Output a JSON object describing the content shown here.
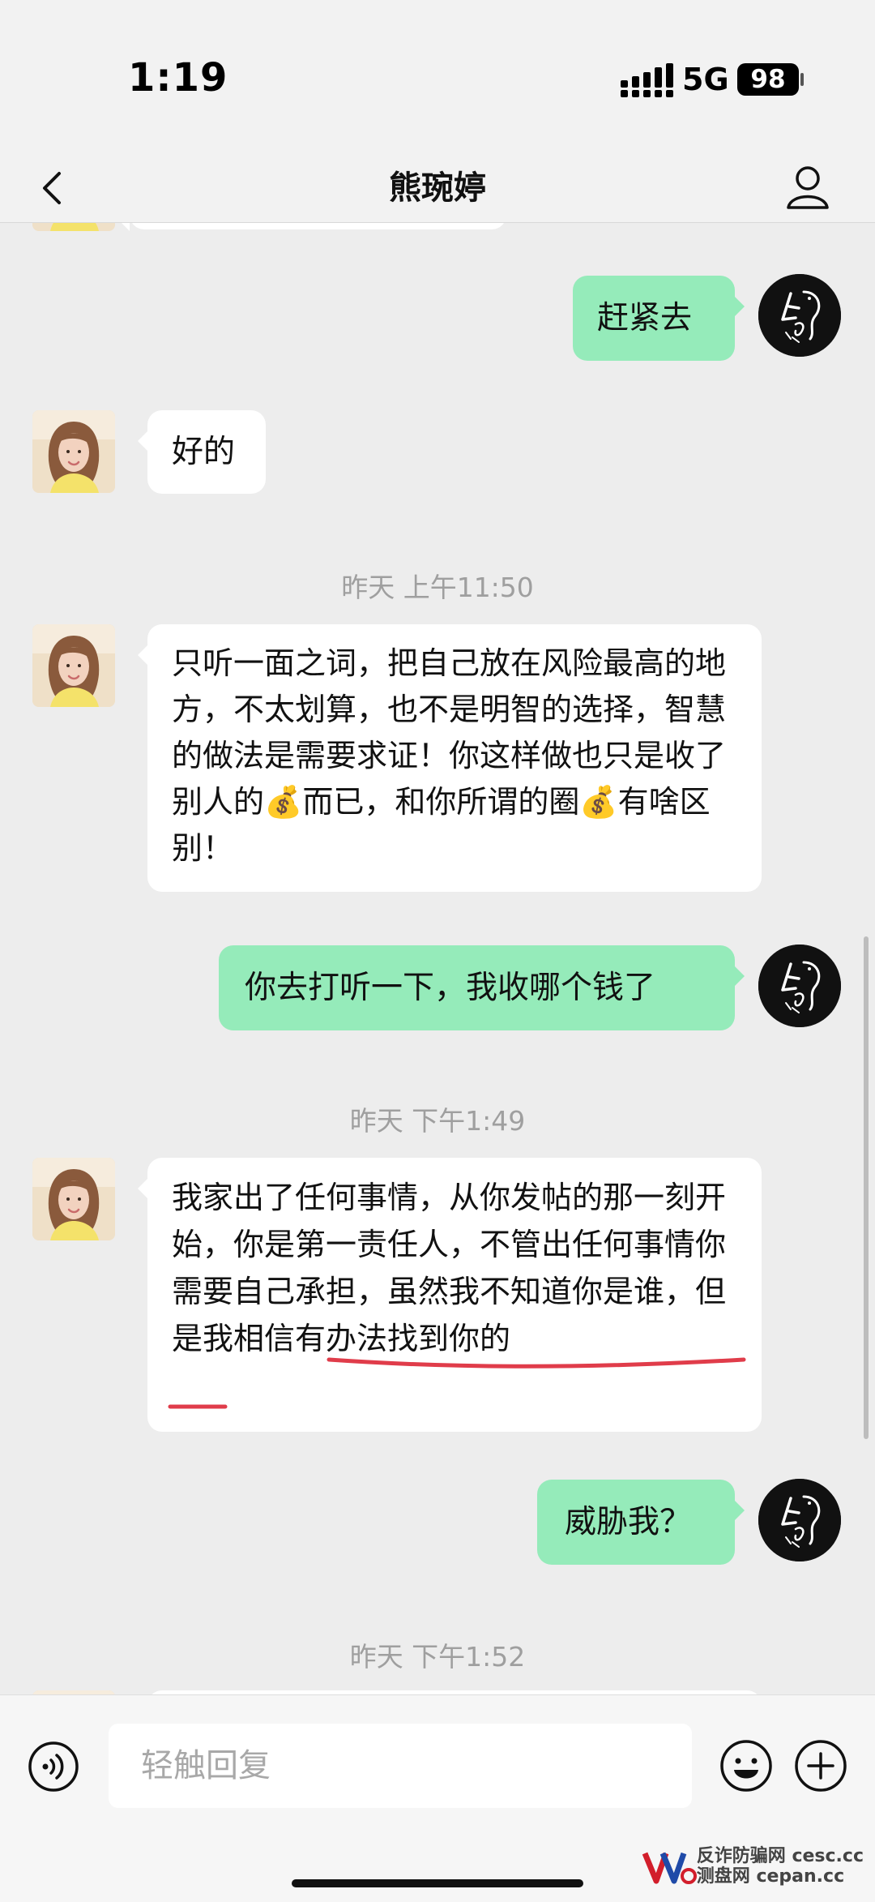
{
  "status_bar": {
    "time": "1:19",
    "network": "5G",
    "battery": "98"
  },
  "header": {
    "title": "熊琬婷",
    "back_icon": "chevron-left-icon",
    "profile_icon": "person-icon"
  },
  "messages": [
    {
      "kind": "message",
      "side": "out",
      "text": "赶紧去"
    },
    {
      "kind": "message",
      "side": "in",
      "text": "好的"
    },
    {
      "kind": "time",
      "text": "昨天 上午11:50"
    },
    {
      "kind": "message",
      "side": "in",
      "text": "只听一面之词，把自己放在风险最高的地方，不太划算，也不是明智的选择，智慧的做法是需要求证！你这样做也只是收了别人的💰而已，和你所谓的圈💰有啥区别！"
    },
    {
      "kind": "message",
      "side": "out",
      "text": "你去打听一下，我收哪个钱了"
    },
    {
      "kind": "time",
      "text": "昨天 下午1:49"
    },
    {
      "kind": "message",
      "side": "in",
      "text": "我家出了任何事情，从你发帖的那一刻开始，你是第一责任人，不管出任何事情你需要自己承担，虽然我不知道你是谁，但是我相信有办法找到你的"
    },
    {
      "kind": "message",
      "side": "out",
      "text": "威胁我？"
    },
    {
      "kind": "time",
      "text": "昨天 下午1:52"
    }
  ],
  "input_bar": {
    "placeholder": "轻触回复",
    "voice_icon": "voice-icon",
    "emoji_icon": "emoji-icon",
    "plus_icon": "plus-icon"
  },
  "watermark": {
    "line1": "反诈防骗网 cesc.cc",
    "line2": "测盘网 cepan.cc"
  },
  "colors": {
    "background": "#ededed",
    "outgoing_bubble": "#95ebba",
    "incoming_bubble": "#ffffff",
    "annotation": "#e03c4a"
  }
}
